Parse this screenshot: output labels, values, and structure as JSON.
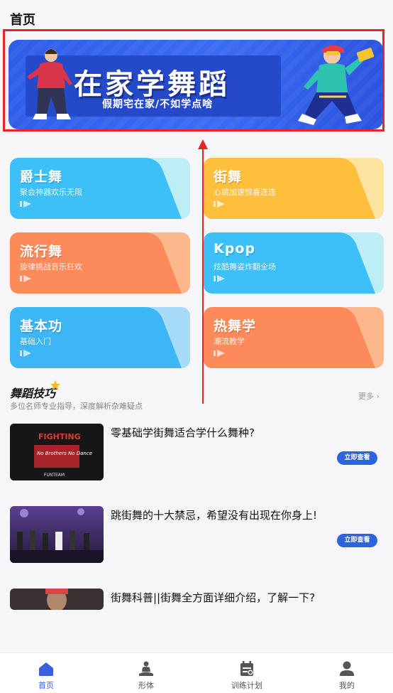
{
  "header": {
    "title": "首页"
  },
  "banner": {
    "title": "在家学舞蹈",
    "subtitle": "假期宅在家/不如学点啥"
  },
  "categories": [
    {
      "title": "爵士舞",
      "subtitle": "聚会神器欢乐无限",
      "theme": "blue"
    },
    {
      "title": "街舞",
      "subtitle": "心跳加速惊喜连连",
      "theme": "yellow"
    },
    {
      "title": "流行舞",
      "subtitle": "旋律挑战音乐狂欢",
      "theme": "orange"
    },
    {
      "title": "Kpop",
      "subtitle": "炫酷舞姿炸翻全场",
      "theme": "blue"
    },
    {
      "title": "基本功",
      "subtitle": "基础入门",
      "theme": "blue"
    },
    {
      "title": "热舞学",
      "subtitle": "潮流教学",
      "theme": "orange"
    }
  ],
  "section": {
    "title": "舞蹈技巧",
    "subtitle": "多位名师专业指导，深度解析杂难疑点",
    "more": "更多 ›"
  },
  "articles": [
    {
      "title": "零基础学街舞适合学什么舞种?",
      "button": "立即查看",
      "thumb_text": "FIGHTING",
      "thumb_text2": "No Brothers No Dance",
      "thumb_text3": "FUNTEAM"
    },
    {
      "title": "跳街舞的十大禁忌，希望没有出现在你身上!",
      "button": "立即查看"
    },
    {
      "title": "街舞科普||街舞全方面详细介绍，了解一下?"
    }
  ],
  "nav": [
    {
      "label": "首页",
      "icon": "home-icon",
      "active": true
    },
    {
      "label": "形体",
      "icon": "meditation-icon",
      "active": false
    },
    {
      "label": "训练计划",
      "icon": "calendar-icon",
      "active": false
    },
    {
      "label": "我的",
      "icon": "user-icon",
      "active": false
    }
  ],
  "colors": {
    "accent": "#2d63dc",
    "annotation": "#e8242b",
    "card_blue": "#3cc0f7",
    "card_yellow": "#fdbf3c",
    "card_orange": "#fd8a5a"
  }
}
